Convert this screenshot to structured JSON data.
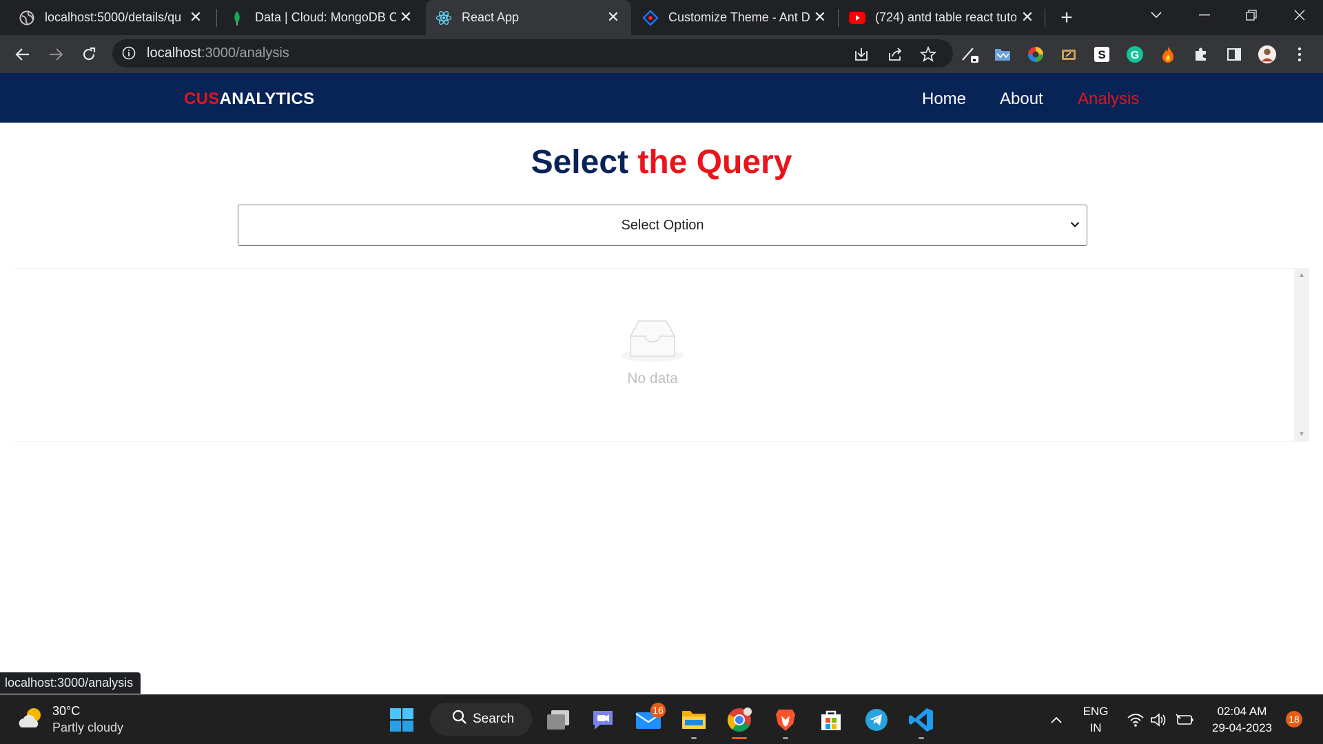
{
  "browser": {
    "tabs": [
      {
        "title": "localhost:5000/details/qu",
        "icon": "globe-icon"
      },
      {
        "title": "Data | Cloud: MongoDB C",
        "icon": "mongodb-leaf-icon"
      },
      {
        "title": "React App",
        "icon": "react-icon",
        "active": true
      },
      {
        "title": "Customize Theme - Ant D",
        "icon": "ant-design-icon"
      },
      {
        "title": "(724) antd table react tuto",
        "icon": "youtube-icon"
      }
    ],
    "address": {
      "host": "localhost",
      "path": ":3000/analysis"
    },
    "status_url": "localhost:3000/analysis"
  },
  "app": {
    "brand": {
      "accent": "CUS",
      "rest": "ANALYTICS"
    },
    "nav": {
      "home": "Home",
      "about": "About",
      "analysis": "Analysis",
      "active": "analysis"
    },
    "heading": {
      "part1": "Select ",
      "part2": "the Query"
    },
    "select": {
      "value": "Select Option"
    },
    "table": {
      "empty_text": "No data",
      "rows": []
    },
    "colors": {
      "navbar": "#082356",
      "accent": "#e3161b"
    }
  },
  "taskbar": {
    "weather": {
      "temp": "30°C",
      "desc": "Partly cloudy"
    },
    "search_label": "Search",
    "mail_badge": "16",
    "language": {
      "lang": "ENG",
      "region": "IN"
    },
    "clock": {
      "time": "02:04 AM",
      "date": "29-04-2023"
    },
    "notification_count": "18"
  }
}
